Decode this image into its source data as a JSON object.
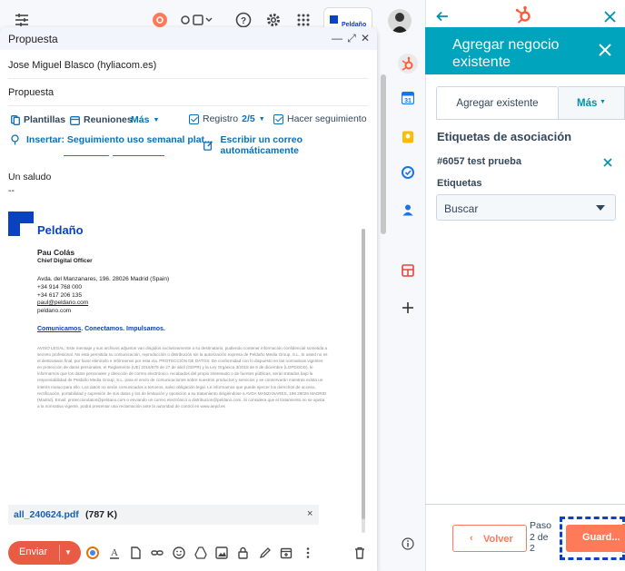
{
  "compose": {
    "title": "Propuesta",
    "to": "Jose Miguel Blasco (hyliacom.es)",
    "subject": "Propuesta",
    "toolbar": {
      "templates": "Plantillas",
      "meetings": "Reuniones",
      "more": "Más",
      "log_label": "Registro",
      "log_value": "2/5",
      "follow_up": "Hacer seguimiento",
      "insert_sequence": "Insertar: Seguimiento uso semanal plat...",
      "write_auto": "Escribir un correo automáticamente"
    },
    "body": {
      "greeting": "Un saludo",
      "dashes": "--"
    },
    "signature": {
      "logo_text": "Peldaño",
      "name": "Pau Colás",
      "role": "Chief Digital Officer",
      "address": "Avda. del Manzanares, 196. 28026 Madrid (Spain)",
      "phone1": "+34 914 768 000",
      "phone2": "+34 617 206 135",
      "email": "paul@peldano.com",
      "web": "peldano.com",
      "tagline_link": "Comunicamos",
      "tagline_rest": ". Conectamos. Impulsamos.",
      "legal": "AVISO LEGAL: Este mensaje y sus archivos adjuntos van dirigidos exclusivamente a su destinatario, pudiendo contener información confidencial sometida a secreto profesional. No está permitida su comunicación, reproducción o distribución sin la autorización expresa de Peldaño Media Group, S.L. Si usted no es el destinatario final, por favor elimínelo e infórmenos por esta vía. PROTECCIÓN DE DATOS: De conformidad con lo dispuesto en las normativas vigentes en protección de datos personales, el Reglamento (UE) 2016/679 de 27 de abril (GDPR) y la Ley Orgánica 3/2018 de 5 de diciembre (LOPDGDD), le informamos que los datos personales y dirección de correo electrónico, recabados del propio interesado o de fuentes públicas, serán tratados bajo la responsabilidad de Peldaño Media Group, S.L. para el envío de comunicaciones sobre nuestros productos y servicios y se conservarán mientras exista un interés mutuo para ello. Los datos no serán comunicados a terceros, salvo obligación legal. Le informamos que puede ejercer los derechos de acceso, rectificación, portabilidad y supresión de sus datos y los de limitación y oposición a su tratamiento dirigiéndose a AVDA MANZANARES, 196 28026 MADRID (Madrid). Email: protecciondatos@peldano.com o enviando un correo electrónico a distribucion@peldano.com. Si considera que el tratamiento no se ajusta a la normativa vigente, podrá presentar una reclamación ante la autoridad de control en www.aepd.es"
    },
    "attachment": {
      "name": "all_240624.pdf",
      "size": "(787 K)",
      "close": "×"
    },
    "send_label": "Enviar"
  },
  "panel": {
    "title": "Agregar negocio existente",
    "tabs": [
      "Agregar existente",
      "Más"
    ],
    "section_title": "Etiquetas de asociación",
    "deal_name": "#6057 test prueba",
    "labels_title": "Etiquetas",
    "select_placeholder": "Buscar",
    "back_label": "Volver",
    "step_text": "Paso 2 de 2",
    "save_label": "Guard..."
  },
  "colors": {
    "hubspot_teal": "#00a4bd",
    "hubspot_orange": "#ff7a59",
    "link_blue": "#0b6fb6",
    "send_red": "#ea5b46"
  }
}
